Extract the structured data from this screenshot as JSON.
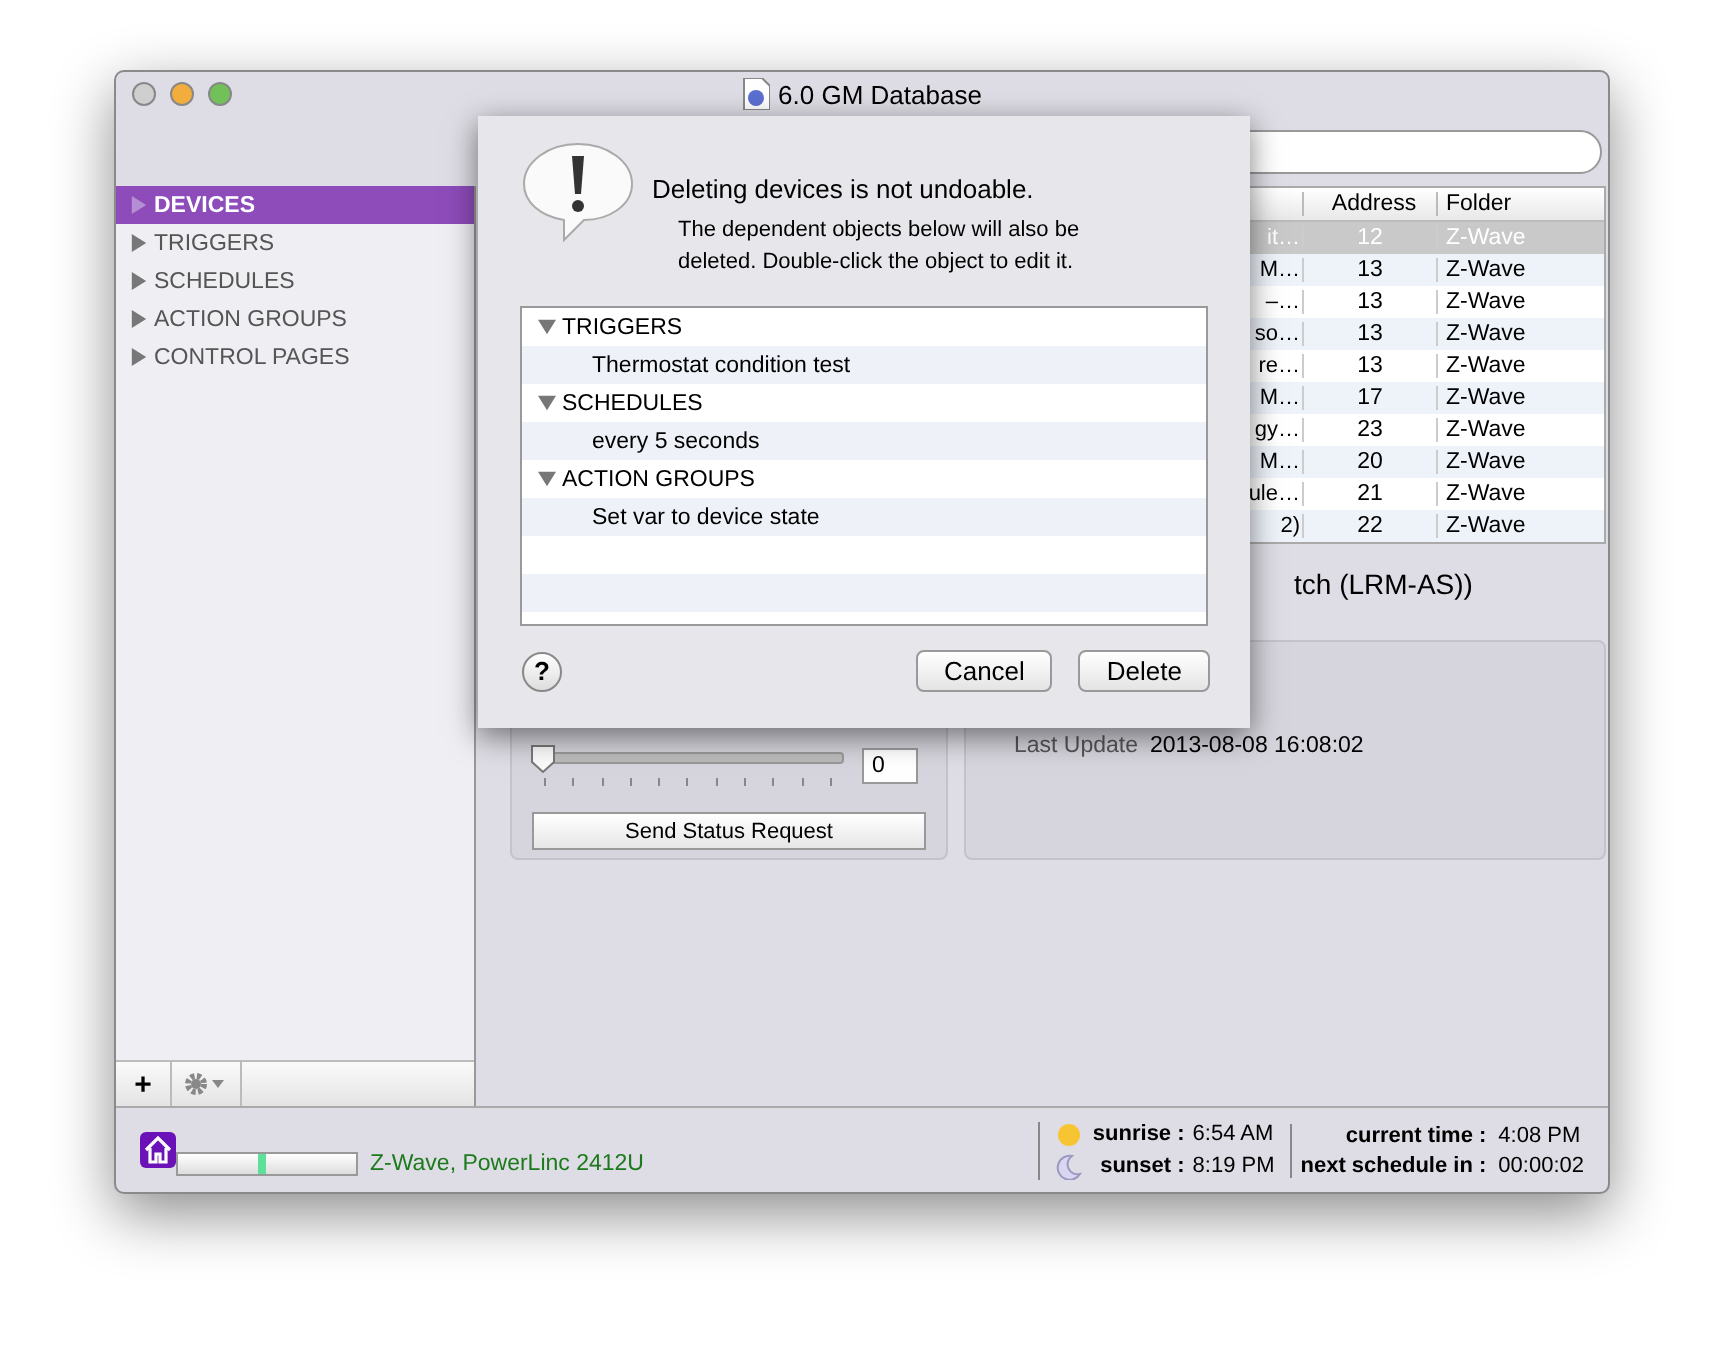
{
  "window": {
    "title": "6.0 GM Database"
  },
  "sidebar": {
    "items": [
      {
        "label": "DEVICES",
        "selected": true
      },
      {
        "label": "TRIGGERS",
        "selected": false
      },
      {
        "label": "SCHEDULES",
        "selected": false
      },
      {
        "label": "ACTION GROUPS",
        "selected": false
      },
      {
        "label": "CONTROL PAGES",
        "selected": false
      }
    ],
    "buttons": [
      "+"
    ]
  },
  "table": {
    "columns": [
      "Address",
      "Folder"
    ],
    "rows": [
      {
        "column_1": "it…",
        "address": "12",
        "folder": "Z-Wave",
        "selected": true
      },
      {
        "column_1": "M…",
        "address": "13",
        "folder": "Z-Wave",
        "selected": false
      },
      {
        "column_1": "–…",
        "address": "13",
        "folder": "Z-Wave",
        "selected": false
      },
      {
        "column_1": "so…",
        "address": "13",
        "folder": "Z-Wave",
        "selected": false
      },
      {
        "column_1": "re…",
        "address": "13",
        "folder": "Z-Wave",
        "selected": false
      },
      {
        "column_1": "M…",
        "address": "17",
        "folder": "Z-Wave",
        "selected": false
      },
      {
        "column_1": "gy…",
        "address": "23",
        "folder": "Z-Wave",
        "selected": false
      },
      {
        "column_1": "M…",
        "address": "20",
        "folder": "Z-Wave",
        "selected": false
      },
      {
        "column_1": "ule…",
        "address": "21",
        "folder": "Z-Wave",
        "selected": false
      },
      {
        "column_1": "2)",
        "address": "22",
        "folder": "Z-Wave",
        "selected": false
      }
    ]
  },
  "device_title": "tch (LRM-AS))",
  "controls": {
    "slider": {
      "level": 0,
      "value": "0"
    },
    "status_button": "Send Status Request"
  },
  "details": {
    "label": "Last Update",
    "value": "2013-08-08 16:08:02"
  },
  "dialog": {
    "title": "Deleting devices is not undoable.",
    "message": "The dependent objects below will also be deleted. Double-click the object to edit it.",
    "outline": [
      {
        "label": "TRIGGERS",
        "expanded": true,
        "children": [
          {
            "label": "Thermostat condition test"
          }
        ]
      },
      {
        "label": "SCHEDULES",
        "expanded": true,
        "children": [
          {
            "label": "every 5 seconds"
          }
        ]
      },
      {
        "label": "ACTION GROUPS",
        "expanded": true,
        "children": [
          {
            "label": "Set var to device state"
          }
        ]
      }
    ],
    "help": "?",
    "buttons": [
      "Cancel",
      "Delete"
    ]
  },
  "status_bar": {
    "connection": "Z-Wave, PowerLinc 2412U",
    "sun": [
      {
        "kind": "sunrise",
        "label": "sunrise :",
        "value": "6:54 AM"
      },
      {
        "kind": "sunset",
        "label": "sunset :",
        "value": "8:19 PM"
      }
    ],
    "clock": [
      {
        "label": "current time :",
        "value": "4:08 PM"
      },
      {
        "label": "next schedule in :",
        "value": "00:00:02"
      }
    ]
  }
}
